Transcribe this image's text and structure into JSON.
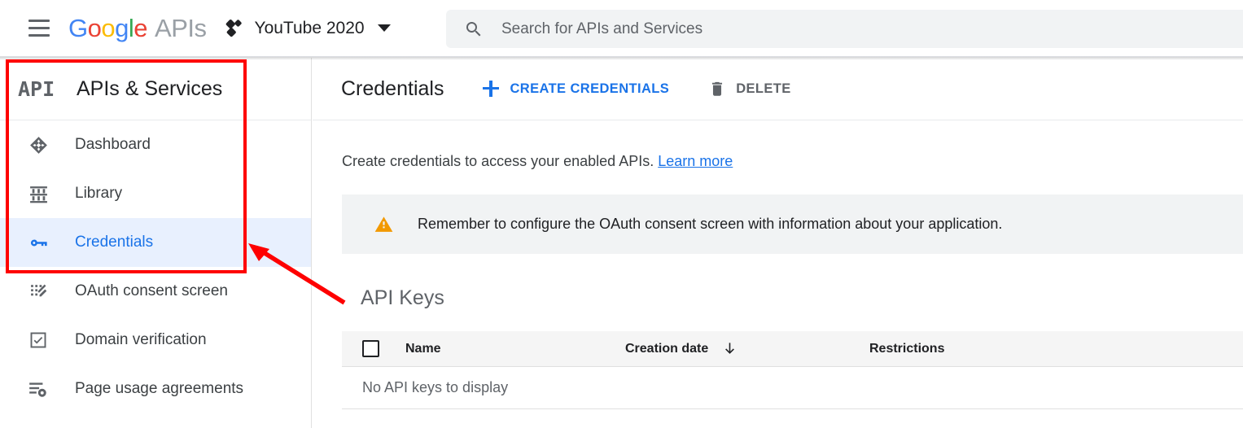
{
  "header": {
    "menu_icon": "hamburger-menu-icon",
    "logo_text": "Google",
    "logo_suffix": "APIs",
    "project_icon": "project-dots-icon",
    "project_name": "YouTube 2020",
    "project_caret_icon": "chevron-down-icon",
    "search": {
      "icon": "search-icon",
      "placeholder": "Search for APIs and Services",
      "value": ""
    }
  },
  "sidebar": {
    "logo_text": "API",
    "title": "APIs & Services",
    "items": [
      {
        "label": "Dashboard",
        "icon": "dashboard-diamond-icon",
        "active": false
      },
      {
        "label": "Library",
        "icon": "library-icon",
        "active": false
      },
      {
        "label": "Credentials",
        "icon": "key-icon",
        "active": true
      },
      {
        "label": "OAuth consent screen",
        "icon": "oauth-pencil-icon",
        "active": false
      },
      {
        "label": "Domain verification",
        "icon": "checkbox-verified-icon",
        "active": false
      },
      {
        "label": "Page usage agreements",
        "icon": "list-gear-icon",
        "active": false
      }
    ]
  },
  "main": {
    "page_title": "Credentials",
    "create_button": "CREATE CREDENTIALS",
    "create_icon": "plus-icon",
    "delete_button": "DELETE",
    "delete_icon": "trash-icon",
    "description": "Create credentials to access your enabled APIs.",
    "learn_more": "Learn more",
    "notice": {
      "icon": "warning-triangle-icon",
      "text": "Remember to configure the OAuth consent screen with information about your application."
    },
    "section_title": "API Keys",
    "table": {
      "select_all_checkbox": "select-all-checkbox",
      "columns": [
        "Name",
        "Creation date",
        "Restrictions"
      ],
      "sort_icon": "sort-descending-arrow-icon",
      "sorted_column": "Creation date",
      "empty_message": "No API keys to display",
      "rows": []
    }
  },
  "annotations": {
    "highlight_box": "red-rectangle-around-sidebar-nav",
    "arrow": "red-arrow-pointing-to-credentials"
  },
  "colors": {
    "accent_blue": "#1a73e8",
    "active_row_bg": "#e8f0fe",
    "annotation_red": "#fe0000",
    "warning_orange": "#f29900",
    "notice_bg": "#f1f3f4",
    "search_bg": "#f1f3f4"
  }
}
